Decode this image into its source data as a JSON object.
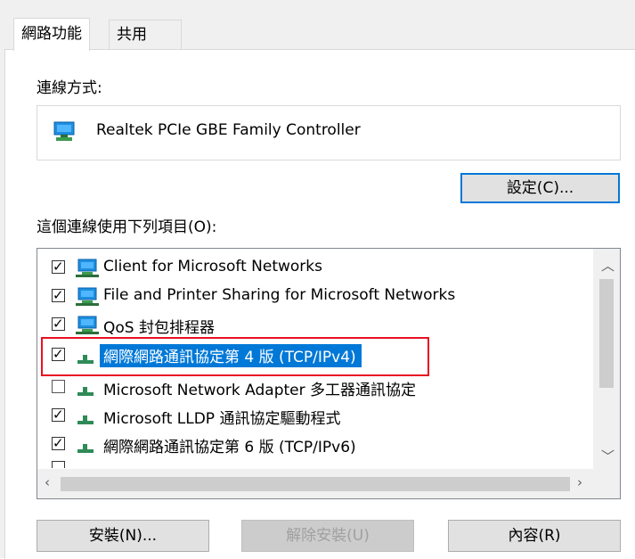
{
  "tabs": [
    {
      "label": "網路功能",
      "active": true
    },
    {
      "label": "共用",
      "active": false
    }
  ],
  "connect_using": {
    "label": "連線方式:",
    "adapter_name": "Realtek PCIe GBE Family Controller",
    "configure_button": "設定(C)..."
  },
  "items_list": {
    "label": "這個連線使用下列項目(O):",
    "items": [
      {
        "label": "Client for Microsoft Networks",
        "checked": true,
        "icon": "monitor-network-icon",
        "selected": false
      },
      {
        "label": "File and Printer Sharing for Microsoft Networks",
        "checked": true,
        "icon": "monitor-network-icon",
        "selected": false
      },
      {
        "label": "QoS 封包排程器",
        "checked": true,
        "icon": "monitor-network-icon",
        "selected": false
      },
      {
        "label": "網際網路通訊協定第 4 版 (TCP/IPv4)",
        "checked": true,
        "icon": "protocol-icon",
        "selected": true
      },
      {
        "label": "Microsoft Network Adapter 多工器通訊協定",
        "checked": false,
        "icon": "protocol-icon",
        "selected": false
      },
      {
        "label": "Microsoft LLDP 通訊協定驅動程式",
        "checked": true,
        "icon": "protocol-icon",
        "selected": false
      },
      {
        "label": "網際網路通訊協定第 6 版 (TCP/IPv6)",
        "checked": true,
        "icon": "protocol-icon",
        "selected": false
      }
    ]
  },
  "buttons": {
    "install": "安裝(N)...",
    "uninstall": "解除安裝(U)",
    "properties": "內容(R)"
  },
  "colors": {
    "selection": "#0078d7",
    "highlight_border": "#e81123",
    "protocol_icon": "#2e8b57"
  }
}
